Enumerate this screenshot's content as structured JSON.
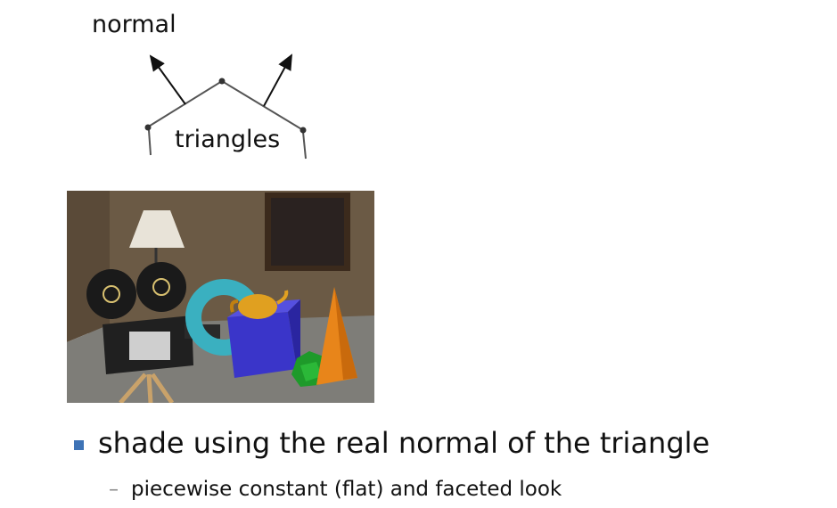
{
  "diagram": {
    "normal_label": "normal",
    "triangles_label": "triangles"
  },
  "render_scene": {
    "objects": [
      "lamp",
      "film-projector",
      "torus",
      "teapot",
      "cube",
      "polyhedron",
      "cone",
      "framed-picture"
    ],
    "colors": {
      "wall": "#6b5a45",
      "floor": "#7d7c78",
      "cube": "#3a35c9",
      "cone": "#e8851a",
      "teapot": "#e0a020",
      "torus": "#3ab0c0",
      "sphere": "#1e9a2a"
    }
  },
  "bullets": [
    {
      "text": "shade using the real normal of the triangle",
      "subitems": [
        "piecewise constant (flat) and faceted look"
      ]
    }
  ],
  "accent_color": "#3e73b6"
}
